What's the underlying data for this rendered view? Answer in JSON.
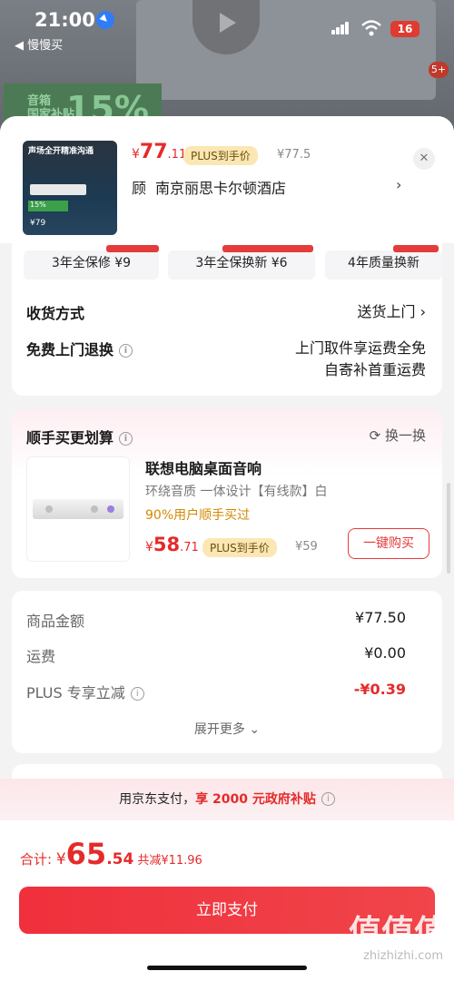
{
  "status_bar": {
    "time": "21:00",
    "back_label": "◀ 慢慢买",
    "battery": "16"
  },
  "background": {
    "subsidy_tag": "15%",
    "tag_text": "音箱\n国家补贴",
    "badge": "5+"
  },
  "sheet_header": {
    "thumb_title": "声场全开精准沟通",
    "thumb_green": "15%",
    "thumb_price": "¥79",
    "price_symbol": "¥",
    "price_int": "77",
    "price_dec": ".11",
    "plus_label": "PLUS到手价",
    "original_price": "¥77.5",
    "store_prefix": "顾",
    "store_name": "南京丽思卡尔顿酒店",
    "chevron": "›",
    "close": "✕"
  },
  "services": {
    "chips": [
      {
        "label": "3年全保修 ¥9"
      },
      {
        "label": "3年全保换新 ¥6"
      },
      {
        "label": "4年质量换新"
      }
    ],
    "delivery_label": "收货方式",
    "delivery_value": "送货上门 ›",
    "return_label": "免费上门退换",
    "return_value_1": "上门取件享运费全免",
    "return_value_2": "自寄补首重运费"
  },
  "recommend": {
    "title": "顺手买更划算",
    "swap": "换一换",
    "product_name": "联想电脑桌面音响",
    "product_desc": "环绕音质 一体设计【有线款】白",
    "percent_text": "90%用户顺手买过",
    "price_symbol": "¥",
    "price_int": "58",
    "price_dec": ".71",
    "plus_label": "PLUS到手价",
    "original_price": "¥59",
    "buy_button": "一键购买"
  },
  "amounts": {
    "rows": [
      {
        "label": "商品金额",
        "value": "¥77.50"
      },
      {
        "label": "运费",
        "value": "¥0.00"
      },
      {
        "label": "PLUS 专享立减",
        "value": "-¥0.39"
      }
    ],
    "expand": "展开更多 ⌄"
  },
  "subsidy": {
    "prefix": "用京东支付，",
    "highlight": "享 2000 元政府补贴"
  },
  "bottom": {
    "total_label": "合计: ",
    "yen": "¥",
    "total_int": "65",
    "total_dec": ".54",
    "save": "共减¥11.96",
    "pay_button": "立即支付",
    "watermark": "值值值",
    "watermark_url": "zhizhizhi.com"
  }
}
